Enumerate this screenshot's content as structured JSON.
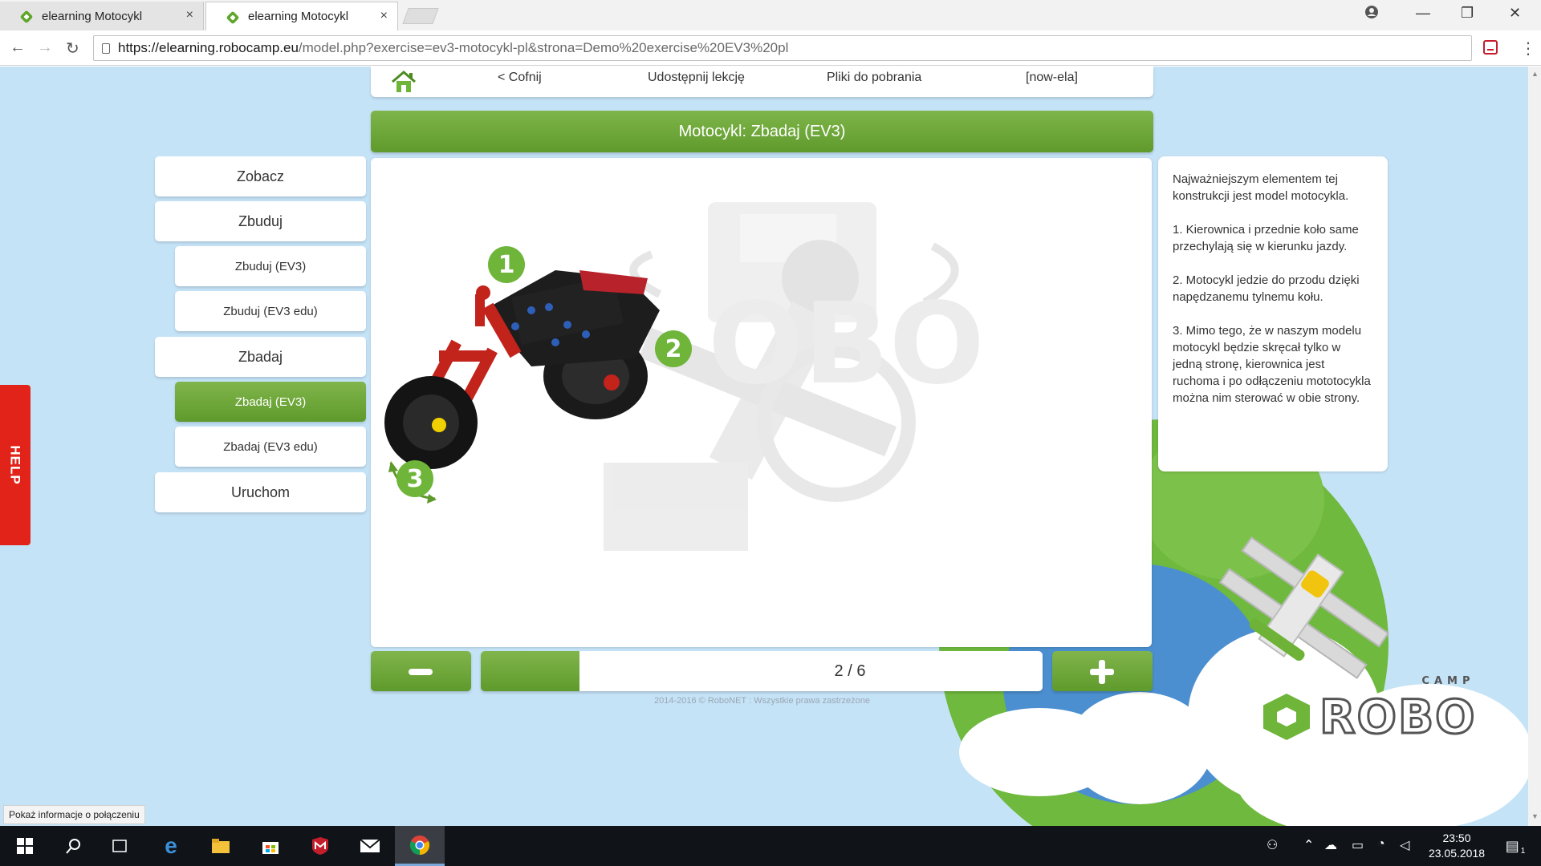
{
  "browser": {
    "tabs": [
      {
        "title": "elearning Motocykl",
        "close": "×"
      },
      {
        "title": "elearning Motocykl",
        "close": "×"
      }
    ],
    "url_host": "https://elearning.robocamp.eu",
    "url_rest": "/model.php?exercise=ev3-motocykl-pl&strona=Demo%20exercise%20EV3%20pl",
    "window_controls": {
      "minimize": "—",
      "maximize": "❐",
      "close": "✕"
    }
  },
  "topnav": {
    "back": "< Cofnij",
    "share": "Udostępnij lekcję",
    "downloads": "Pliki do pobrania",
    "user": "[now-ela]"
  },
  "lesson_title": "Motocykl: Zbadaj (EV3)",
  "menu": [
    {
      "label": "Zobacz",
      "level": "main",
      "active": false
    },
    {
      "label": "Zbuduj",
      "level": "main",
      "active": false
    },
    {
      "label": "Zbuduj (EV3)",
      "level": "sub",
      "active": false
    },
    {
      "label": "Zbuduj (EV3 edu)",
      "level": "sub",
      "active": false
    },
    {
      "label": "Zbadaj",
      "level": "main",
      "active": false
    },
    {
      "label": "Zbadaj (EV3)",
      "level": "sub",
      "active": true
    },
    {
      "label": "Zbadaj (EV3 edu)",
      "level": "sub",
      "active": false
    },
    {
      "label": "Uruchom",
      "level": "main",
      "active": false
    }
  ],
  "markers": [
    "1",
    "2",
    "3"
  ],
  "info": {
    "intro": "Najważniejszym elementem tej konstrukcji jest model motocykla.",
    "point1": "1. Kierownica i przednie koło same przechylają się w kierunku jazdy.",
    "point2": "2. Motocykl jedzie do przodu dzięki napędzanemu tylnemu kołu.",
    "point3": "3. Mimo tego, że w naszym modelu motocykl będzie skręcał tylko w jedną stronę, kierownica jest ruchoma i po odłączeniu mototocykla można nim sterować w obie strony."
  },
  "pager": {
    "current": 2,
    "total": 6,
    "text": "2 / 6",
    "progress": 0.175
  },
  "copyright": "2014-2016 © RoboNET : Wszystkie prawa zastrzeżone",
  "help_label": "HELP",
  "brand": {
    "word": "ROBO",
    "camp": "CAMP"
  },
  "status_tip": "Pokaż informacje o połączeniu",
  "taskbar": {
    "time": "23:50",
    "date": "23.05.2018",
    "notifications": "1"
  },
  "colors": {
    "green": "#6eb53a",
    "sky": "#c5e3f7",
    "help_red": "#e2231a"
  }
}
